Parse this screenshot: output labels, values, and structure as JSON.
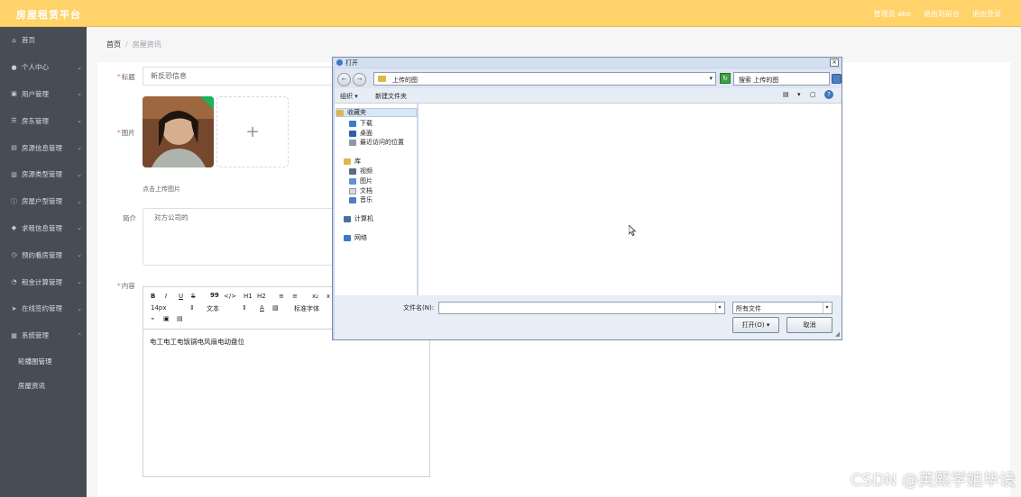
{
  "header": {
    "brand": "房屋租赁平台",
    "nav": [
      "管理员 abo",
      "退出到前台",
      "退出登录"
    ]
  },
  "sidebar": {
    "items": [
      {
        "label": "首页",
        "icon": "home-icon"
      },
      {
        "label": "个人中心",
        "icon": "user-icon"
      },
      {
        "label": "用户管理",
        "icon": "users-icon"
      },
      {
        "label": "房东管理",
        "icon": "list-icon"
      },
      {
        "label": "房源信息管理",
        "icon": "house-icon"
      },
      {
        "label": "房源类型管理",
        "icon": "bar-chart-icon"
      },
      {
        "label": "房屋户型管理",
        "icon": "info-icon"
      },
      {
        "label": "求租信息管理",
        "icon": "location-icon"
      },
      {
        "label": "预约看房管理",
        "icon": "clock-icon"
      },
      {
        "label": "租金计算管理",
        "icon": "timer-icon"
      },
      {
        "label": "在线签约管理",
        "icon": "send-icon"
      },
      {
        "label": "系统管理",
        "icon": "settings-icon"
      }
    ],
    "subitems": [
      "轮播图管理",
      "房屋资讯"
    ]
  },
  "breadcrumb": {
    "home": "首页",
    "current": "房屋资讯"
  },
  "form": {
    "title_label": "标题",
    "title_value": "新反恐信息",
    "image_label": "图片",
    "upload_hint": "点击上传图片",
    "intro_label": "简介",
    "intro_value": "对方公司的",
    "content_label": "内容",
    "editor_content": "电工电工电饭锅电风扇电动盘位",
    "editor_tools": {
      "bold": "B",
      "italic": "I",
      "underline": "U",
      "strike": "S",
      "quote": "99",
      "code": "</>",
      "h1": "H1",
      "h2": "H2",
      "ol": "≡",
      "ul": "≡",
      "sub": "x₂",
      "sup": "x",
      "size": "14px",
      "text": "文本",
      "font": "标准字体",
      "color": "A",
      "bg": "▧",
      "link": "⌁",
      "image": "▣",
      "video": "▤"
    }
  },
  "dialog": {
    "title": "打开",
    "address": "上传的图",
    "search_placeholder": "搜索 上传的图",
    "toolbar": {
      "organize": "组织 ▾",
      "new_folder": "新建文件夹"
    },
    "nav": {
      "favorites": "收藏夹",
      "favorites_items": [
        "下载",
        "桌面",
        "最近访问的位置"
      ],
      "library": "库",
      "library_items": [
        "视频",
        "图片",
        "文档",
        "音乐"
      ],
      "computer": "计算机",
      "network": "网络"
    },
    "filename_label": "文件名(N):",
    "filetype": "所有文件",
    "open_button": "打开(O)",
    "cancel_button": "取消"
  },
  "watermark": "CSDN @英熙学姐毕设"
}
